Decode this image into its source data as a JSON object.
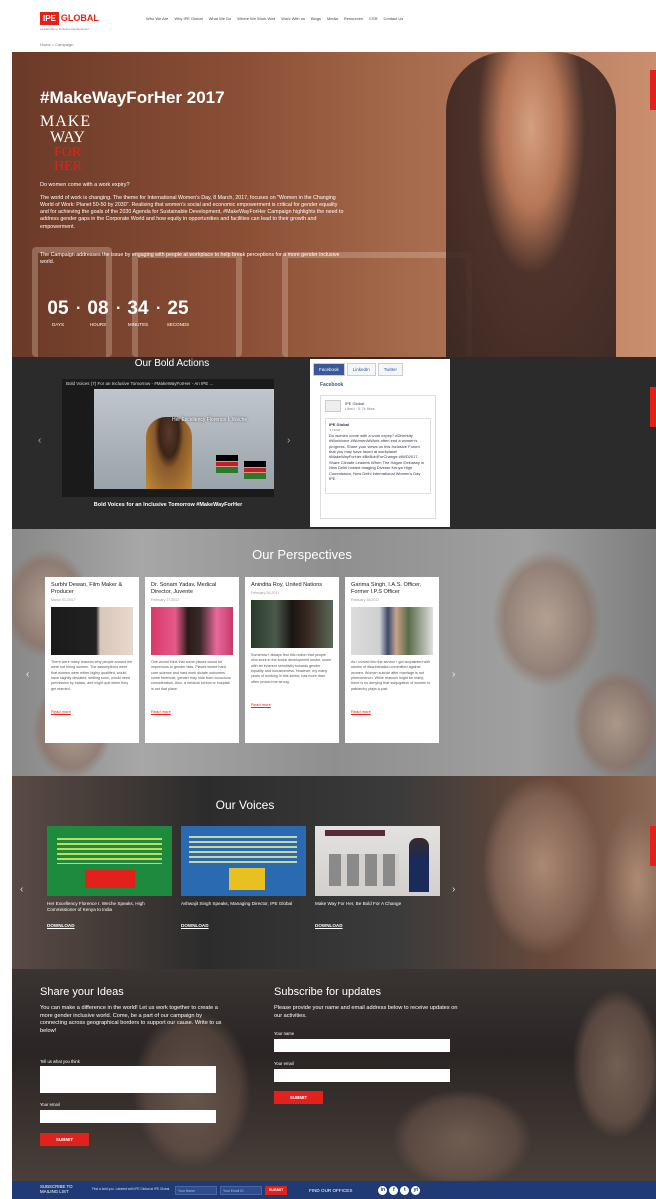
{
  "header": {
    "logo_box": "IPE",
    "logo_text": "GLOBAL",
    "tagline": "Leadership in Inclusive Development",
    "nav": [
      "Who We Are",
      "Why IPE Global",
      "What We Do",
      "Where We Work Well",
      "Work With us",
      "Blogs",
      "Media",
      "Resources",
      "CSR",
      "Contact Us"
    ],
    "breadcrumb": "Home > Campaign"
  },
  "hero": {
    "title": "#MakeWayForHer 2017",
    "logo_lines": [
      "MAKE",
      "WAY",
      "FOR",
      "HER"
    ],
    "question": "Do women come with a work expiry?",
    "p1": "The world of work is changing. The theme for International Women's Day, 8 March, 2017, focuses on \"Women in the Changing World of Work: Planet 50-50 by 2030\". Realising that women's social and economic empowerment is critical for gender equality and for achieving the goals of the 2030 Agenda for Sustainable Development, #MakeWayForHer Campaign highlights the need to address gender gaps in the Corporate World and how equity in opportunities and facilities can lead to their growth and empowerment.",
    "p2": "The Campaign addresses the issue by engaging with people at workplace to help break perceptions for a more gender inclusive world.",
    "countdown": [
      {
        "value": "05",
        "label": "DAYS"
      },
      {
        "value": "08",
        "label": "HOURS"
      },
      {
        "value": "34",
        "label": "MINUTES"
      },
      {
        "value": "25",
        "label": "SECONDS"
      }
    ]
  },
  "bold_actions": {
    "title": "Our Bold Actions",
    "video_title": "Bold Voices (7) For an Inclusive Tomorrow - #MakeWayForHer - An IPE ...",
    "video_name": "Her Excellency Florence I. Weche",
    "caption": "Bold Voices for an Inclusive Tomorrow #MakeWayForHer",
    "social_tabs": [
      "Facebook",
      "LinkedIn",
      "Twitter"
    ],
    "social_label": "Facebook",
    "feed_page": "IPE Global",
    "feed_likes": "Liked · 5.7k likes",
    "feed_post_author": "IPE Global",
    "feed_post_time": "1 hour",
    "feed_post": "Do women come with a work expiry? #Diversity #Workforce #WomenAtWork often end a women's progress. Share your views on this Inclusive Forum that you may have faced at workplace! #MakeWayForHer #BeBoldForChange #IWD2017. Share Climate Leaders When The Hague Embassy in New Delhi hosted Imaging Diverse Kenya High Commission, New Delhi International Women's Day IPE"
  },
  "perspectives": {
    "title": "Our Perspectives",
    "cards": [
      {
        "name": "Surbhi Dewan, Film Maker & Producer",
        "date": "March 02,2017",
        "text": "There were many reasons why people around me were not hiring women. The assumptions were that women were either highly qualified, would have slightly deviated, settling soon, would need permission by inlaws, and might quit when they get married.",
        "more": "Read more"
      },
      {
        "name": "Dr. Sonam Yadav, Medical Director, Juvente",
        "date": "February 27,2017",
        "text": "One would think that some places would be impervious to gender bias. Places where hard core science and hard work dictate outcomes come foremost, gender may hide from conscious consideration. Also, a medical school or hospital, is not that place.",
        "more": "Read more"
      },
      {
        "name": "Anindita Roy, United Nations",
        "date": "February 28,2017",
        "text": "Somehow I always find this notion that people who work in the social development sector, some with an inherent sensitivity towards gender equality and inclusiveness. However, my many years of working in this sector, has more than often proved me wrong.",
        "more": "Read more"
      },
      {
        "name": "Garima Singh, I.A.S. Officer, Former I.P.S Officer",
        "date": "February 28,2017",
        "text": "As I moved into the service I got acquainted with stories of discrimination committed against women. Women suicide after marriage is not phenomenon. While reasons might be many, there is no denying that subjugation of women to patriarchy plays a part.",
        "more": "Read more"
      }
    ]
  },
  "voices": {
    "title": "Our Voices",
    "cards": [
      {
        "caption": "Her Excellency Florence I. Weche Speaks, High Commissioner of Kenya to India",
        "download": "DOWNLOAD"
      },
      {
        "caption": "Ashwajit Singh Speaks, Managing Director, IPE Global",
        "download": "DOWNLOAD"
      },
      {
        "caption": "Make Way For Her, Be Bold For A Change",
        "download": "DOWNLOAD"
      }
    ]
  },
  "share": {
    "title": "Share your Ideas",
    "text": "You can make a difference in the world! Let us work together to create a more gender inclusive world. Come, be a part of our campaign by connecting across geographical borders to support our cause. Write to us below!",
    "label_think": "Tell us what you think",
    "label_email": "Your email",
    "submit": "SUBMIT"
  },
  "subscribe": {
    "title": "Subscribe for updates",
    "text": "Please provide your name and email address below to receive updates on our activities.",
    "label_name": "Your name",
    "label_email": "Your email",
    "submit": "SUBMIT"
  },
  "footer": {
    "subscribe": "SUBSCRIBE TO MAILING LIST",
    "note": "Find a bold you. Labeled with IPE Global at IPE Global.",
    "name_placeholder": "Your Name",
    "email_placeholder": "Your Email ID",
    "submit": "SUBMIT",
    "offices": "FIND OUR OFFICES",
    "social_icons": [
      "in",
      "f",
      "t",
      "yt"
    ]
  },
  "colors": {
    "brand_red": "#e2211c",
    "footer_blue": "#1f3a74"
  }
}
